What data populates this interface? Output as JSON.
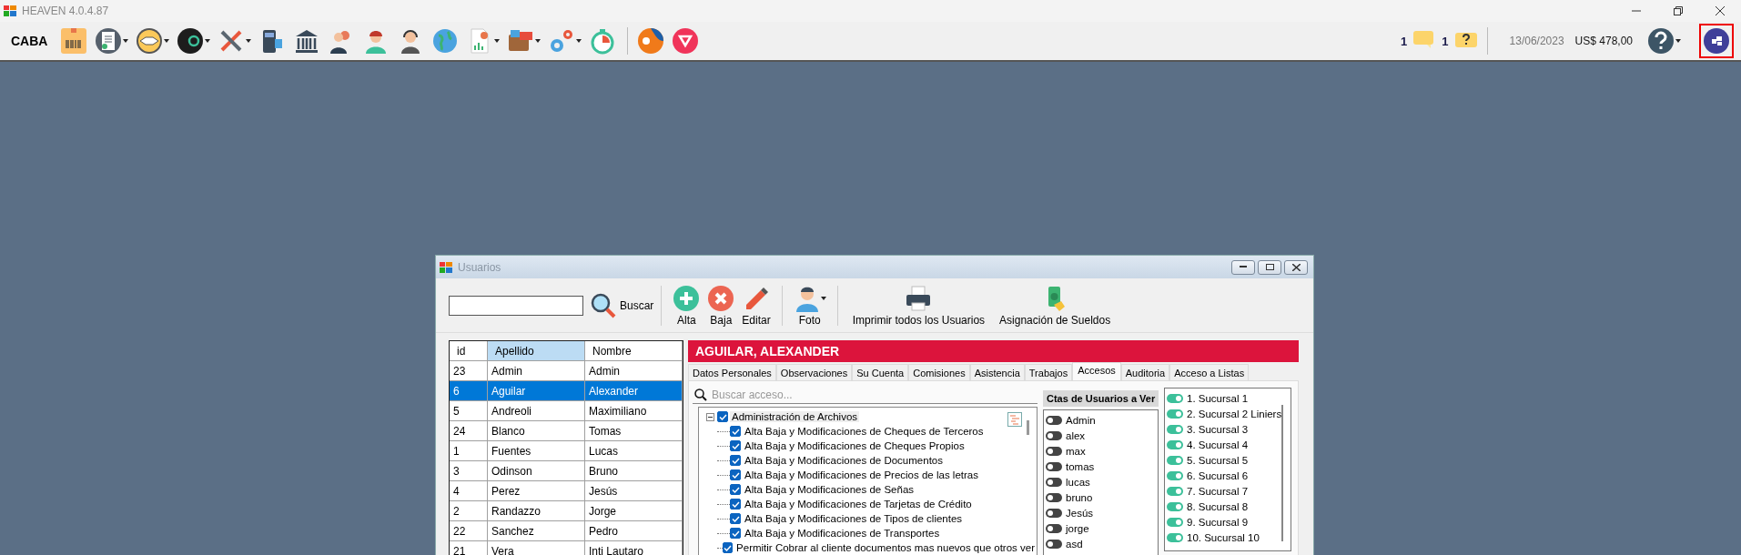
{
  "window": {
    "title": "HEAVEN 4.0.4.87"
  },
  "toolbar": {
    "location": "CABA",
    "tools": [
      {
        "kind": "barcode",
        "dropdown": false
      },
      {
        "kind": "invoice",
        "dropdown": true
      },
      {
        "kind": "handshake",
        "dropdown": true
      },
      {
        "kind": "logo",
        "dropdown": true
      },
      {
        "kind": "tools",
        "dropdown": true
      },
      {
        "kind": "register",
        "dropdown": false
      },
      {
        "kind": "bank",
        "dropdown": false
      },
      {
        "kind": "people",
        "dropdown": false
      },
      {
        "kind": "person",
        "dropdown": false
      },
      {
        "kind": "headset",
        "dropdown": false
      },
      {
        "kind": "globe",
        "dropdown": false
      },
      {
        "kind": "report",
        "dropdown": true
      },
      {
        "kind": "wallet",
        "dropdown": true
      },
      {
        "kind": "gears",
        "dropdown": true
      },
      {
        "kind": "stopwatch",
        "dropdown": false
      }
    ],
    "apps": [
      {
        "kind": "ball"
      },
      {
        "kind": "pink"
      }
    ],
    "messages": [
      {
        "kind": "chat",
        "count": "1"
      },
      {
        "kind": "question",
        "count": "1"
      }
    ],
    "date": "13/06/2023",
    "balance": "US$ 478,00",
    "help_dropdown": true
  },
  "dialog": {
    "title": "Usuarios",
    "search_button": "Buscar",
    "actions": [
      {
        "kind": "add",
        "label": "Alta",
        "dropdown": false
      },
      {
        "kind": "delete",
        "label": "Baja",
        "dropdown": false
      },
      {
        "kind": "edit",
        "label": "Editar",
        "dropdown": false
      },
      {
        "kind": "photo",
        "label": "Foto",
        "dropdown": true
      },
      {
        "kind": "print",
        "label": "Imprimir todos los Usuarios",
        "dropdown": false
      },
      {
        "kind": "salary",
        "label": "Asignación de Sueldos",
        "dropdown": false
      }
    ],
    "users_table": {
      "columns": [
        {
          "label": "id",
          "selected": false
        },
        {
          "label": "Apellido",
          "selected": true
        },
        {
          "label": "Nombre",
          "selected": false
        }
      ],
      "rows": [
        {
          "id": "23",
          "apellido": "Admin",
          "nombre": "Admin",
          "selected": false
        },
        {
          "id": "6",
          "apellido": "Aguilar",
          "nombre": "Alexander",
          "selected": true
        },
        {
          "id": "5",
          "apellido": "Andreoli",
          "nombre": "Maximiliano",
          "selected": false
        },
        {
          "id": "24",
          "apellido": "Blanco",
          "nombre": "Tomas",
          "selected": false
        },
        {
          "id": "1",
          "apellido": "Fuentes",
          "nombre": "Lucas",
          "selected": false
        },
        {
          "id": "3",
          "apellido": "Odinson",
          "nombre": "Bruno",
          "selected": false
        },
        {
          "id": "4",
          "apellido": "Perez",
          "nombre": "Jesús",
          "selected": false
        },
        {
          "id": "2",
          "apellido": "Randazzo",
          "nombre": "Jorge",
          "selected": false
        },
        {
          "id": "22",
          "apellido": "Sanchez",
          "nombre": "Pedro",
          "selected": false
        },
        {
          "id": "21",
          "apellido": "Vera",
          "nombre": "Inti Lautaro",
          "selected": false
        }
      ]
    },
    "banner": "AGUILAR, ALEXANDER",
    "tabs": [
      {
        "label": "Datos Personales",
        "selected": false
      },
      {
        "label": "Observaciones",
        "selected": false
      },
      {
        "label": "Su Cuenta",
        "selected": false
      },
      {
        "label": "Comisiones",
        "selected": false
      },
      {
        "label": "Asistencia",
        "selected": false
      },
      {
        "label": "Trabajos",
        "selected": false
      },
      {
        "label": "Accesos",
        "selected": true
      },
      {
        "label": "Auditoria",
        "selected": false
      },
      {
        "label": "Acceso a Listas",
        "selected": false
      }
    ],
    "access_search": {
      "placeholder": "Buscar acceso..."
    },
    "access_tree": [
      {
        "label": "Administración de Archivos",
        "checked": true,
        "expanded": true,
        "children": [
          {
            "label": "Alta Baja y Modificaciones de Cheques de Terceros",
            "checked": true
          },
          {
            "label": "Alta Baja y Modificaciones de Cheques Propios",
            "checked": true
          },
          {
            "label": "Alta Baja y Modificaciones de Documentos",
            "checked": true
          },
          {
            "label": "Alta Baja y Modificaciones de Precios de las letras",
            "checked": true
          },
          {
            "label": "Alta Baja y Modificaciones de Señas",
            "checked": true
          },
          {
            "label": "Alta Baja y Modificaciones de Tarjetas de Crédito",
            "checked": true
          },
          {
            "label": "Alta Baja y Modificaciones de Tipos de clientes",
            "checked": true
          },
          {
            "label": "Alta Baja y Modificaciones de Transportes",
            "checked": true
          },
          {
            "label": "Permitir Cobrar al cliente documentos mas nuevos que otros ver",
            "checked": true
          }
        ]
      }
    ],
    "user_accounts": {
      "title": "Ctas de Usuarios a Ver",
      "items": [
        {
          "label": "Admin",
          "on": false
        },
        {
          "label": "alex",
          "on": false
        },
        {
          "label": "max",
          "on": false
        },
        {
          "label": "tomas",
          "on": false
        },
        {
          "label": "lucas",
          "on": false
        },
        {
          "label": "bruno",
          "on": false
        },
        {
          "label": "Jesús",
          "on": false
        },
        {
          "label": "jorge",
          "on": false
        },
        {
          "label": "asd",
          "on": false
        }
      ]
    },
    "branches": [
      {
        "label": "1. Sucursal 1",
        "on": true
      },
      {
        "label": "2. Sucursal 2 Liniers",
        "on": true
      },
      {
        "label": "3. Sucursal 3",
        "on": true
      },
      {
        "label": "4. Sucursal 4",
        "on": true
      },
      {
        "label": "5. Sucursal 5",
        "on": true
      },
      {
        "label": "6. Sucursal 6",
        "on": true
      },
      {
        "label": "7. Sucursal 7",
        "on": true
      },
      {
        "label": "8. Sucursal 8",
        "on": true
      },
      {
        "label": "9. Sucursal 9",
        "on": true
      },
      {
        "label": "10. Sucursal 10",
        "on": true
      }
    ]
  }
}
